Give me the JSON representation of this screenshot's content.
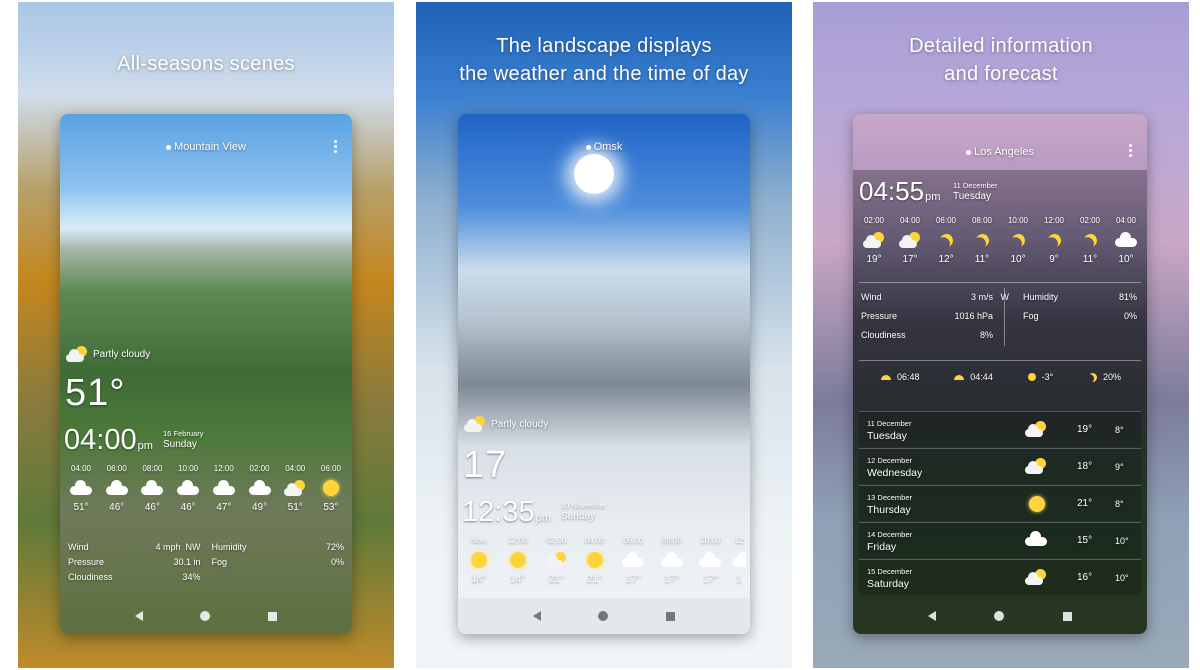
{
  "panels": [
    {
      "headline": [
        "All-seasons scenes"
      ],
      "city": "Mountain View",
      "condition": "Partly cloudy",
      "temperature": "51°",
      "time": "04:00",
      "ampm": "pm",
      "date": "16 February",
      "day": "Sunday",
      "hours": [
        {
          "t": "04:00",
          "icon": "cloud-icon",
          "temp": "51°"
        },
        {
          "t": "06:00",
          "icon": "cloud-icon",
          "temp": "46°"
        },
        {
          "t": "08:00",
          "icon": "cloud-icon",
          "temp": "46°"
        },
        {
          "t": "10:00",
          "icon": "cloud-icon",
          "temp": "46°"
        },
        {
          "t": "12:00",
          "icon": "cloud-icon",
          "temp": "47°"
        },
        {
          "t": "02:00",
          "icon": "cloud-icon",
          "temp": "49°"
        },
        {
          "t": "04:00",
          "icon": "partly-cloudy-icon",
          "temp": "51°"
        },
        {
          "t": "06:00",
          "icon": "sun-icon",
          "temp": "53°"
        }
      ],
      "details": {
        "wind_label": "Wind",
        "wind_value": "4 mph",
        "wind_dir": "NW",
        "pressure_label": "Pressure",
        "pressure_value": "30.1 in",
        "cloudiness_label": "Cloudiness",
        "cloudiness_value": "34%",
        "humidity_label": "Humidity",
        "humidity_value": "72%",
        "fog_label": "Fog",
        "fog_value": "0%"
      }
    },
    {
      "headline": [
        "The landscape displays",
        "the weather and the time of day"
      ],
      "city": "Omsk",
      "condition": "Partly cloudy",
      "temperature": "17",
      "time": "12:35",
      "ampm": "pm",
      "date": "10 November",
      "day": "Sunday",
      "hours": [
        {
          "t": "Now",
          "icon": "sun-icon",
          "temp": "14°"
        },
        {
          "t": "12:00",
          "icon": "sun-icon",
          "temp": "14°"
        },
        {
          "t": "02:00",
          "icon": "partly-cloudy-icon",
          "temp": "21°"
        },
        {
          "t": "04:00",
          "icon": "sun-icon",
          "temp": "21°"
        },
        {
          "t": "06:00",
          "icon": "cloud-icon",
          "temp": "17°"
        },
        {
          "t": "08:00",
          "icon": "cloud-icon",
          "temp": "17°"
        },
        {
          "t": "10:00",
          "icon": "cloud-icon",
          "temp": "17°"
        },
        {
          "t": "12",
          "icon": "cloud-icon",
          "temp": "1"
        }
      ]
    },
    {
      "headline": [
        "Detailed information",
        "and forecast"
      ],
      "city": "Los Angeles",
      "time": "04:55",
      "ampm": "pm",
      "date": "11 December",
      "day": "Tuesday",
      "hours": [
        {
          "t": "02:00",
          "icon": "partly-cloudy-icon",
          "temp": "19°"
        },
        {
          "t": "04:00",
          "icon": "partly-cloudy-icon",
          "temp": "17°"
        },
        {
          "t": "06:00",
          "icon": "moon-icon",
          "temp": "12°"
        },
        {
          "t": "08:00",
          "icon": "moon-icon",
          "temp": "11°"
        },
        {
          "t": "10:00",
          "icon": "moon-icon",
          "temp": "10°"
        },
        {
          "t": "12:00",
          "icon": "moon-icon",
          "temp": "9°"
        },
        {
          "t": "02:00",
          "icon": "moon-icon",
          "temp": "11°"
        },
        {
          "t": "04:00",
          "icon": "cloud-icon",
          "temp": "10°"
        }
      ],
      "details": {
        "wind_label": "Wind",
        "wind_value": "3 m/s",
        "wind_dir": "W",
        "pressure_label": "Pressure",
        "pressure_value": "1016 hPa",
        "cloudiness_label": "Cloudiness",
        "cloudiness_value": "8%",
        "humidity_label": "Humidity",
        "humidity_value": "81%",
        "fog_label": "Fog",
        "fog_value": "0%"
      },
      "astro": {
        "sunrise": "06:48",
        "sunset": "04:44",
        "temp": "-3°",
        "moon": "20%"
      },
      "forecast": [
        {
          "date": "11 December",
          "day": "Tuesday",
          "icon": "partly-cloudy-icon",
          "hi": "19°",
          "lo": "8°"
        },
        {
          "date": "12 December",
          "day": "Wednesday",
          "icon": "partly-cloudy-icon",
          "hi": "18°",
          "lo": "9°"
        },
        {
          "date": "13 December",
          "day": "Thursday",
          "icon": "sun-icon",
          "hi": "21°",
          "lo": "8°"
        },
        {
          "date": "14 December",
          "day": "Friday",
          "icon": "cloud-icon",
          "hi": "15°",
          "lo": "10°"
        },
        {
          "date": "15 December",
          "day": "Saturday",
          "icon": "partly-cloudy-icon",
          "hi": "16°",
          "lo": "10°"
        }
      ]
    }
  ],
  "colors": {
    "sun": "#ffd43b",
    "text": "#ffffff"
  }
}
